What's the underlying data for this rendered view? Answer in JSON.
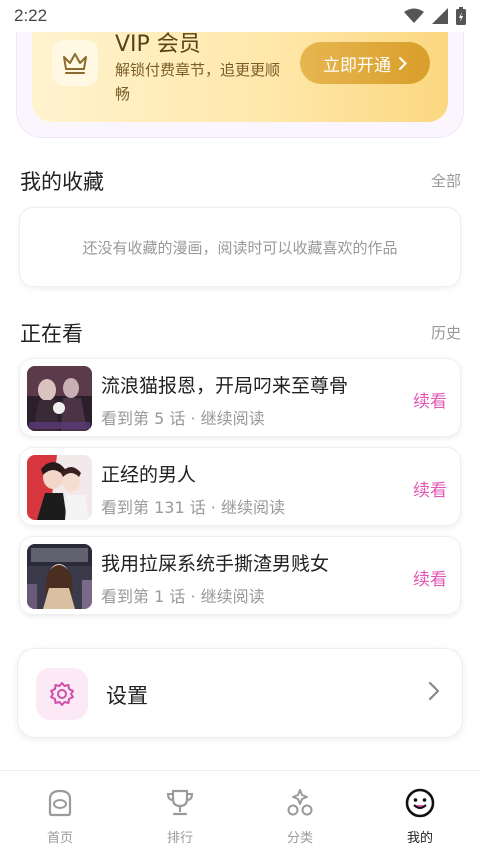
{
  "status_bar": {
    "time": "2:22"
  },
  "vip": {
    "title": "VIP 会员",
    "desc": "解锁付费章节，追更更顺畅",
    "button_label": "立即开通"
  },
  "favorites": {
    "title": "我的收藏",
    "link": "全部",
    "empty_text": "还没有收藏的漫画，阅读时可以收藏喜欢的作品"
  },
  "reading": {
    "title": "正在看",
    "link": "历史",
    "items": [
      {
        "title": "流浪猫报恩，开局叼来至尊骨",
        "progress": "看到第 5 话 · 继续阅读",
        "action": "续看"
      },
      {
        "title": "正经的男人",
        "progress": "看到第 131 话 · 继续阅读",
        "action": "续看"
      },
      {
        "title": "我用拉屎系统手撕渣男贱女",
        "progress": "看到第 1 话 · 继续阅读",
        "action": "续看"
      }
    ]
  },
  "settings": {
    "label": "设置"
  },
  "tabbar": {
    "tabs": [
      {
        "label": "首页"
      },
      {
        "label": "排行"
      },
      {
        "label": "分类"
      },
      {
        "label": "我的"
      }
    ],
    "active": "我的"
  },
  "colors": {
    "accent_pink": "#e259b5",
    "vip_gold": "#d99e2b"
  }
}
